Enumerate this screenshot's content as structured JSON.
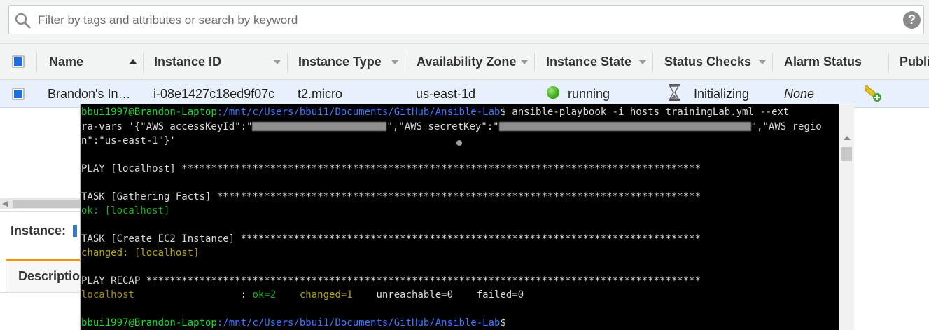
{
  "search": {
    "placeholder": "Filter by tags and attributes or search by keyword",
    "help": "?"
  },
  "table": {
    "columns": [
      "Name",
      "Instance ID",
      "Instance Type",
      "Availability Zone",
      "Instance State",
      "Status Checks",
      "Alarm Status",
      "Publi"
    ],
    "row": {
      "name": "Brandon's In…",
      "instance_id": "i-08e1427c18ed9f07c",
      "instance_type": "t2.micro",
      "availability_zone": "us-east-1d",
      "instance_state": "running",
      "status_checks": "Initializing",
      "alarm_status": "None"
    }
  },
  "details": {
    "instance_label": "Instance:",
    "tab_description": "Descriptio"
  },
  "terminal": {
    "prompt_user": "bbui1997@Brandon-Laptop",
    "prompt_path": ":/mnt/c/Users/bbui1/Documents/GitHub/Ansible-Lab",
    "prompt_sign": "$",
    "command": " ansible-playbook -i hosts trainingLab.yml --ext",
    "cmd_line2_a": "ra-vars '{\"AWS_accessKeyId\":\"",
    "cmd_line2_b": "\",\"AWS_secretKey\":\"",
    "cmd_line2_c": "\",\"AWS_regio",
    "cmd_line3": "n\":\"us-east-1\"}'",
    "play_line": "PLAY [localhost] ****************************************************************************************",
    "task1_line": "TASK [Gathering Facts] **********************************************************************************",
    "task1_result": "ok: [localhost]",
    "task2_line": "TASK [Create EC2 Instance] ******************************************************************************",
    "task2_result": "changed: [localhost]",
    "recap_line": "PLAY RECAP **********************************************************************************************",
    "recap_host": "localhost                  ",
    "recap_colon": ": ",
    "recap_ok": "ok=2",
    "recap_gap1": "    ",
    "recap_changed": "changed=1",
    "recap_rest": "    unreachable=0    failed=0"
  },
  "colors": {
    "selection_blue": "#1f6fd8",
    "row_highlight": "#e8f0fb",
    "terminal_bg": "#000000",
    "prompt_green": "#1adc2e",
    "path_blue": "#3b78ff",
    "tab_orange": "#f29100"
  }
}
